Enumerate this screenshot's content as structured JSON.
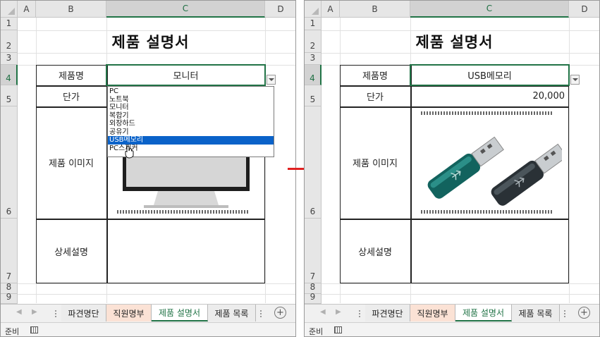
{
  "columns": [
    "A",
    "B",
    "C",
    "D"
  ],
  "rows": [
    "1",
    "2",
    "3",
    "4",
    "5",
    "6",
    "7",
    "8",
    "9"
  ],
  "left": {
    "title": "제품 설명서",
    "labels": {
      "name": "제품명",
      "price": "단가",
      "image": "제품 이미지",
      "detail": "상세설명"
    },
    "product_value": "모니터",
    "image_name": "monitor-image",
    "dropdown": {
      "options": [
        "PC",
        "노트북",
        "모니터",
        "복합기",
        "외장하드",
        "공유기",
        "USB메모리",
        "PC스피커"
      ],
      "highlighted": "USB메모리"
    }
  },
  "right": {
    "title": "제품 설명서",
    "labels": {
      "name": "제품명",
      "price": "단가",
      "image": "제품 이미지",
      "detail": "상세설명"
    },
    "product_value": "USB메모리",
    "price_value": "20,000",
    "image_name": "usb-drive-image"
  },
  "sheet_tabs": [
    "파견명단",
    "직원명부",
    "제품 설명서",
    "제품 목록"
  ],
  "active_tab": "제품 설명서",
  "status": {
    "text": "준비"
  },
  "colors": {
    "accent": "#217346",
    "highlight": "#0a62c9",
    "tab_orange": "#fbe2d5",
    "arrow": "#e02020",
    "usb_teal": "#12635e",
    "usb_dark": "#2a3136"
  }
}
